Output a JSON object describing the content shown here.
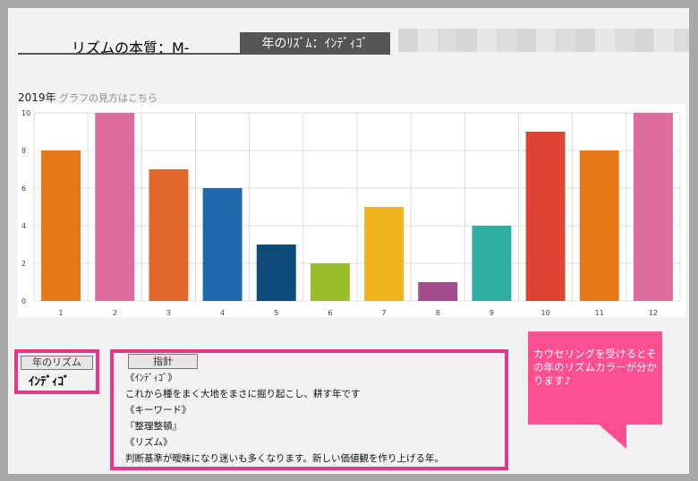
{
  "header": {
    "title": "リズムの本質：M-",
    "year_rhythm_tab": "年のﾘｽﾞﾑ：ｲﾝﾃﾞｨｺﾞ"
  },
  "chart_heading": {
    "year": "2019年",
    "howto_link": "グラフの見方はこちら"
  },
  "chart_data": {
    "type": "bar",
    "categories": [
      "1",
      "2",
      "3",
      "4",
      "5",
      "6",
      "7",
      "8",
      "9",
      "10",
      "11",
      "12"
    ],
    "values": [
      8,
      10,
      7,
      6,
      3,
      2,
      5,
      1,
      4,
      9,
      8,
      10
    ],
    "colors": [
      "#e57a14",
      "#dd6b9d",
      "#e0682c",
      "#1f69ad",
      "#0c4a7a",
      "#9abd2a",
      "#efb51e",
      "#a34d8e",
      "#2eaea0",
      "#dd4431",
      "#e57a14",
      "#dd6b9d"
    ],
    "ylim": [
      0,
      10
    ],
    "yticks": [
      "0",
      "2",
      "4",
      "6",
      "8",
      "10"
    ],
    "grid": true,
    "title": "",
    "xlabel": "",
    "ylabel": ""
  },
  "rhythm_box": {
    "label": "年のリズム",
    "value": "ｲﾝﾃﾞｨｺﾞ"
  },
  "guide_box": {
    "label": "指針",
    "lines": [
      "《ｲﾝﾃﾞｨｺﾞ》",
      "これから種をまく大地をまさに掘り起こし、耕す年です",
      "《キーワード》",
      "『整理整頓』",
      "《リズム》",
      "判断基準が曖昧になり迷いも多くなります。新しい価値観を作り上げる年。"
    ]
  },
  "bubble": {
    "text": "カウセリングを受けるとその年のリズムカラーが分かります♪"
  }
}
